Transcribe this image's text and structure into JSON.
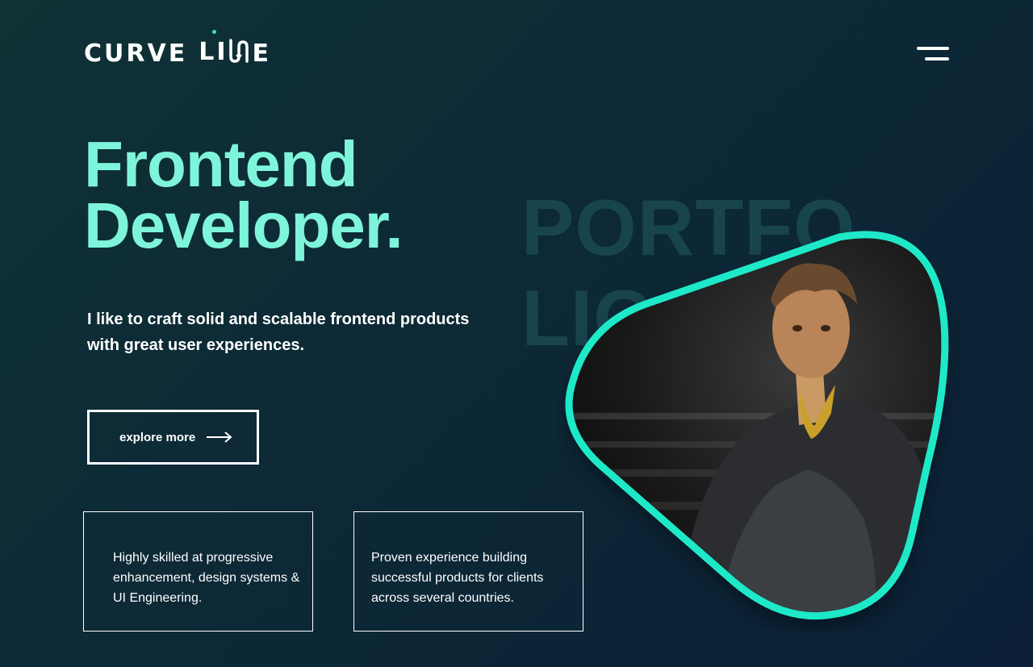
{
  "header": {
    "logo_part1": "CURVE",
    "logo_part2": "LI",
    "logo_part3": "E",
    "logo_icon": "curve-line-logo",
    "menu_icon": "hamburger-menu-icon"
  },
  "hero": {
    "title_line1": "Frontend",
    "title_line2": "Developer.",
    "tagline": "I like to craft solid and scalable frontend products with great user experiences.",
    "cta_label": "explore more",
    "cta_icon": "arrow-right-icon"
  },
  "features": [
    {
      "text": "Highly skilled at progressive enhancement, design systems & UI Engineering."
    },
    {
      "text": "Proven experience building successful products for clients across several countries."
    }
  ],
  "backdrop": {
    "line1": "PORTFO",
    "line2": "LIO"
  },
  "colors": {
    "accent": "#7ef5da",
    "frame": "#1de9c9",
    "background": "#0d2a36"
  }
}
